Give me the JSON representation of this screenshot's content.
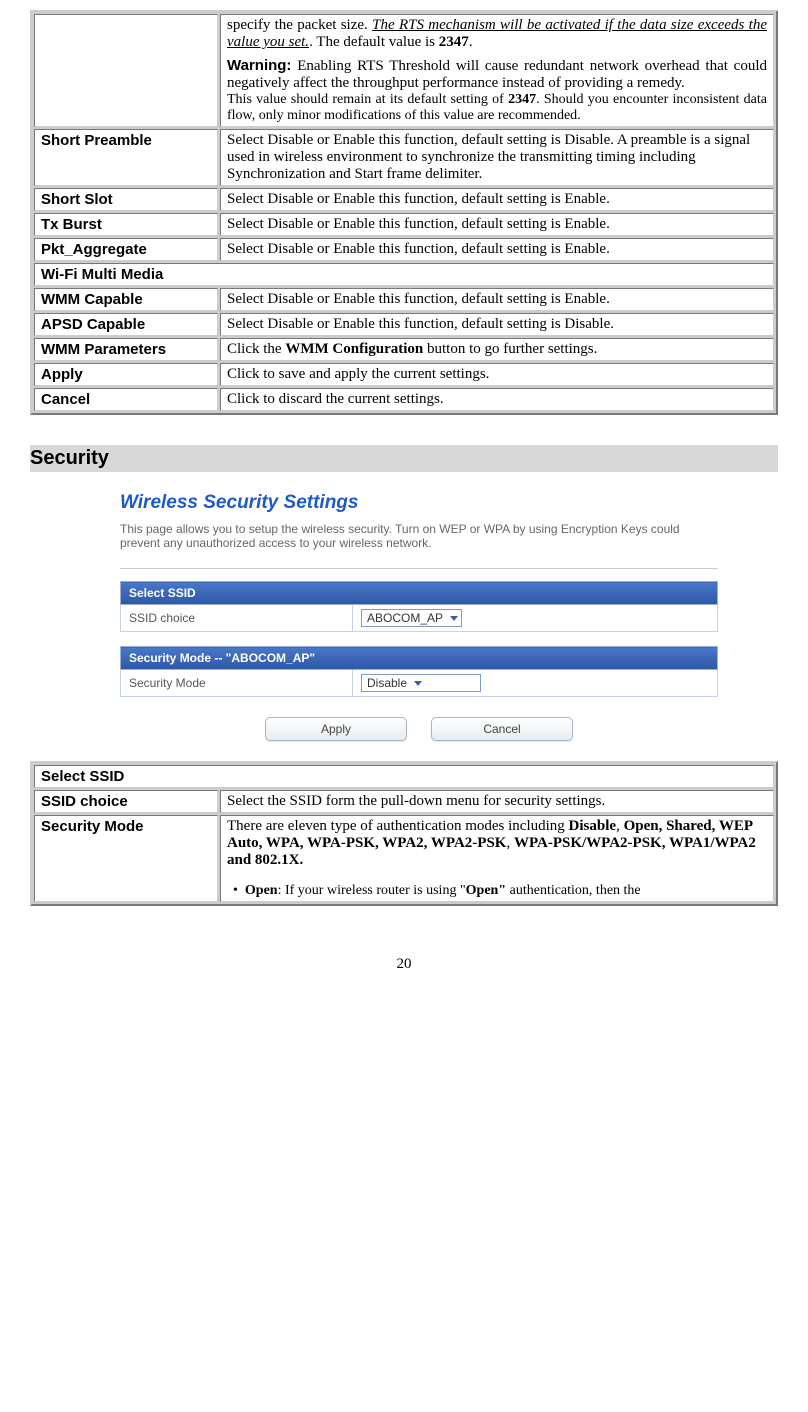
{
  "table1": {
    "rts": {
      "pre_text": "specify the packet size. ",
      "underline_text": "The RTS mechanism will be activated if the data size exceeds the value you set.",
      "post_dot": ". The default value is ",
      "default_value": "2347",
      "post_dot2": ".",
      "warning_label": "Warning:",
      "warning_text": " Enabling RTS Threshold will cause redundant network overhead that could negatively affect the throughput performance instead of providing a remedy.",
      "note": "This value should remain at its default setting of ",
      "note_bold": "2347",
      "note2": ".  Should you encounter inconsistent data flow, only minor modifications of this value are recommended."
    },
    "rows": [
      {
        "label": "Short Preamble",
        "desc": "Select Disable or Enable this function, default setting is Disable. A preamble is a signal used in wireless environment to synchronize the transmitting timing including Synchronization and Start frame delimiter."
      },
      {
        "label": "Short Slot",
        "desc": "Select Disable or Enable this function, default setting is Enable."
      },
      {
        "label": "Tx Burst",
        "desc": "Select Disable or Enable this function, default setting is Enable."
      },
      {
        "label": "Pkt_Aggregate",
        "desc": "Select Disable or Enable this function, default setting is Enable."
      }
    ],
    "wmm_header": "Wi-Fi Multi Media",
    "wmm_rows": [
      {
        "label": "WMM Capable",
        "desc": "Select Disable or Enable this function, default setting is Enable."
      },
      {
        "label": "APSD Capable",
        "desc": "Select Disable or Enable this function, default setting is Disable."
      },
      {
        "label": "WMM Parameters",
        "desc_pre": "Click the ",
        "desc_bold": "WMM Configuration",
        "desc_post": " button to go further settings."
      },
      {
        "label": "Apply",
        "desc": "Click to save and apply the current settings."
      },
      {
        "label": "Cancel",
        "desc": "Click to discard the current settings."
      }
    ]
  },
  "security_heading": "Security",
  "screenshot": {
    "title": "Wireless Security Settings",
    "desc": "This page allows you to setup the wireless security. Turn on WEP or WPA by using Encryption Keys could prevent any unauthorized access to your wireless network.",
    "ssid_header": "Select SSID",
    "ssid_label": "SSID choice",
    "ssid_value": "ABOCOM_AP",
    "secmode_header": "Security Mode -- \"ABOCOM_AP\"",
    "secmode_label": "Security Mode",
    "secmode_value": "Disable",
    "btn_apply": "Apply",
    "btn_cancel": "Cancel"
  },
  "table2": {
    "header": "Select SSID",
    "rows": {
      "ssid": {
        "label": "SSID choice",
        "desc": "Select the SSID form the pull-down menu for security settings."
      },
      "secmode": {
        "label": "Security Mode",
        "desc_pre": "There are eleven type of authentication modes including ",
        "desc_bold1": "Disable",
        "desc_mid": ", ",
        "desc_bold2": "Open, Shared, WEP Auto, WPA, WPA-PSK, WPA2, WPA2-PSK",
        "desc_mid2": ", ",
        "desc_bold3": "WPA-PSK/WPA2-PSK, WPA1/WPA2 and 802.1X.",
        "bullet_label": "Open",
        "bullet_text": ": If your wireless router is using \"",
        "bullet_bold": "Open\"",
        "bullet_post": " authentication, then the"
      }
    }
  },
  "page_number": "20"
}
